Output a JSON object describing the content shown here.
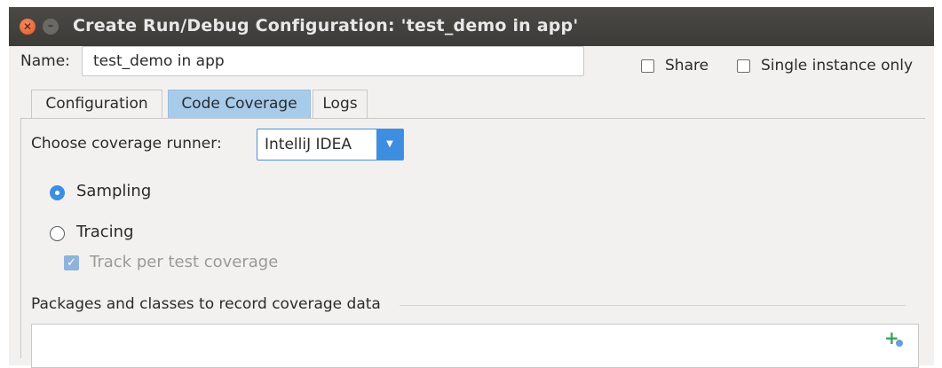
{
  "window": {
    "title": "Create Run/Debug Configuration: 'test_demo in app'"
  },
  "form": {
    "name_label": "Name:",
    "name_value": "test_demo in app",
    "share_label": "Share",
    "share_checked": false,
    "single_instance_label": "Single instance only",
    "single_instance_checked": false
  },
  "tabs": [
    {
      "label": "Configuration",
      "active": false
    },
    {
      "label": "Code Coverage",
      "active": true
    },
    {
      "label": "Logs",
      "active": false
    }
  ],
  "coverage": {
    "runner_label": "Choose coverage runner:",
    "runner_value": "IntelliJ IDEA",
    "options": [
      {
        "label": "Sampling",
        "selected": true
      },
      {
        "label": "Tracing",
        "selected": false
      }
    ],
    "track_label": "Track per test coverage",
    "track_checked": true,
    "track_enabled": false,
    "packages_label": "Packages and classes to record coverage data"
  },
  "icons": {
    "close": "close-icon",
    "minimize": "minimize-icon",
    "add": "add-class-icon"
  },
  "colors": {
    "accent": "#3d8ee0",
    "active_tab": "#a6cbeb",
    "titlebar": "#3c3b37"
  }
}
